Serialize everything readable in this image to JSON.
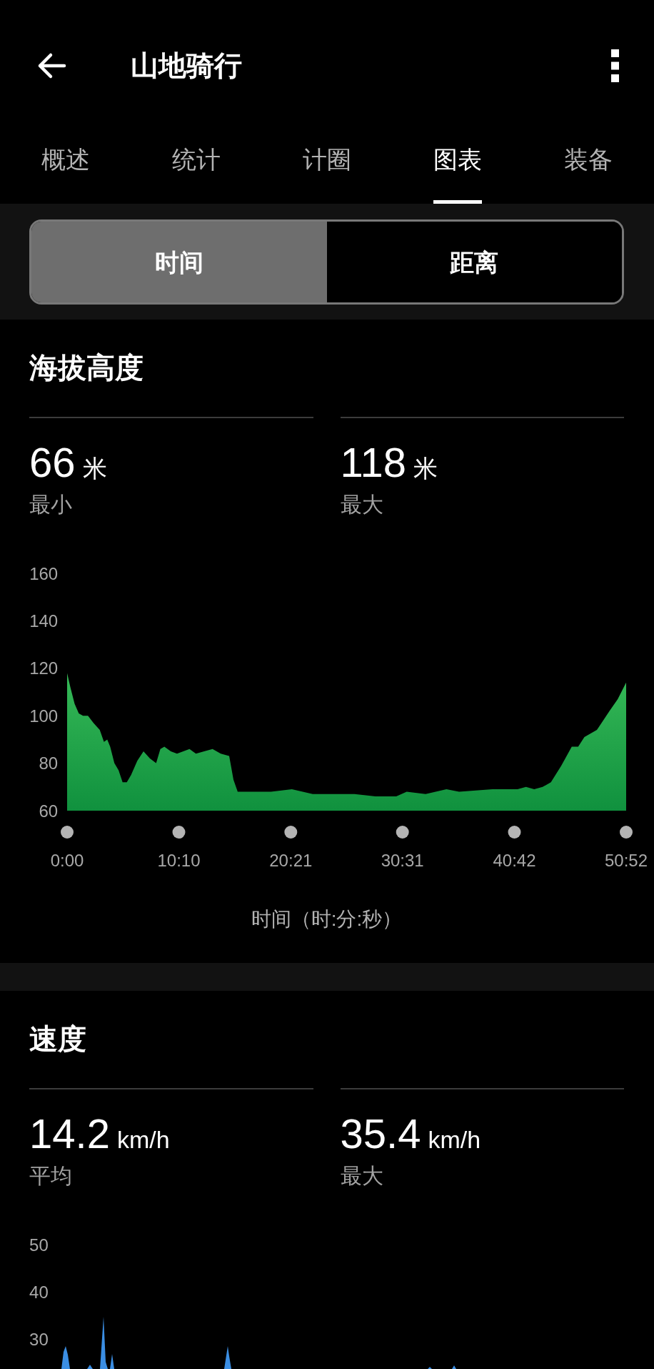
{
  "header": {
    "title": "山地骑行"
  },
  "tabs": [
    {
      "label": "概述",
      "selected": false
    },
    {
      "label": "统计",
      "selected": false
    },
    {
      "label": "计圈",
      "selected": false
    },
    {
      "label": "图表",
      "selected": true
    },
    {
      "label": "装备",
      "selected": false
    }
  ],
  "axis_toggle": [
    {
      "label": "时间",
      "selected": true
    },
    {
      "label": "距离",
      "selected": false
    }
  ],
  "sections": [
    {
      "title": "海拔高度",
      "stats": [
        {
          "value": "66",
          "unit": "米",
          "label": "最小"
        },
        {
          "value": "118",
          "unit": "米",
          "label": "最大"
        }
      ],
      "chart_data": {
        "type": "area",
        "xlabel": "时间（时:分:秒）",
        "x": [
          0,
          18,
          41,
          64,
          87,
          114,
          144,
          178,
          201,
          219,
          235,
          258,
          281,
          303,
          326,
          349,
          383,
          417,
          452,
          486,
          509,
          531,
          566,
          600,
          634,
          668,
          703,
          748,
          794,
          839,
          885,
          908,
          931,
          999,
          1113,
          1227,
          1341,
          1455,
          1569,
          1683,
          1797,
          1854,
          1957,
          2071,
          2140,
          2322,
          2459,
          2505,
          2550,
          2596,
          2641,
          2698,
          2755,
          2790,
          2824,
          2892,
          2961,
          3006,
          3052
        ],
        "values": [
          118,
          112,
          105,
          101,
          100,
          100,
          97,
          94,
          89,
          90,
          87,
          80,
          77,
          72,
          72,
          75,
          81,
          85,
          82,
          80,
          86,
          87,
          85,
          84,
          85,
          86,
          84,
          85,
          86,
          84,
          83,
          73,
          68,
          68,
          68,
          69,
          67,
          67,
          67,
          66,
          66,
          68,
          67,
          69,
          68,
          69,
          69,
          70,
          69,
          70,
          72,
          79,
          87,
          87,
          91,
          94,
          102,
          107,
          114
        ],
        "xlim": [
          0,
          3052
        ],
        "ylim": [
          60,
          160
        ],
        "xticks": [
          {
            "value": 0,
            "label": "0:00"
          },
          {
            "value": 610,
            "label": "10:10"
          },
          {
            "value": 1221,
            "label": "20:21"
          },
          {
            "value": 1831,
            "label": "30:31"
          },
          {
            "value": 2442,
            "label": "40:42"
          },
          {
            "value": 3052,
            "label": "50:52"
          }
        ],
        "yticks": [
          60,
          80,
          100,
          120,
          140,
          160
        ]
      }
    },
    {
      "title": "速度",
      "stats": [
        {
          "value": "14.2",
          "unit": "km/h",
          "label": "平均"
        },
        {
          "value": "35.4",
          "unit": "km/h",
          "label": "最大"
        }
      ],
      "y_axis_labels": [
        "50",
        "40",
        "30"
      ]
    }
  ]
}
